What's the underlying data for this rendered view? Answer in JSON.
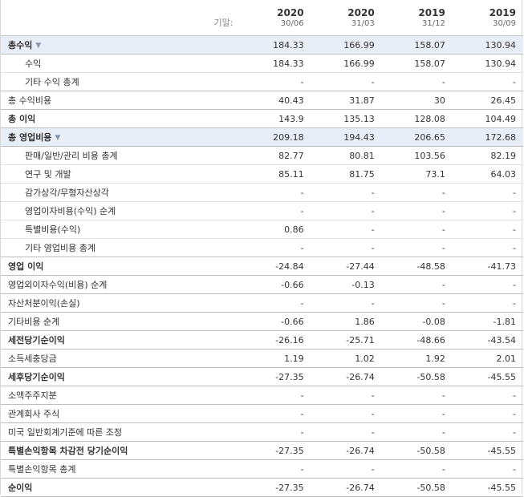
{
  "header": {
    "label": "기말:",
    "columns": [
      {
        "year": "2020",
        "date": "30/06"
      },
      {
        "year": "2020",
        "date": "31/03"
      },
      {
        "year": "2019",
        "date": "31/12"
      },
      {
        "year": "2019",
        "date": "30/09"
      }
    ]
  },
  "rows": [
    {
      "label": "총수익",
      "values": [
        "184.33",
        "166.99",
        "158.07",
        "130.94"
      ]
    },
    {
      "label": "수익",
      "values": [
        "184.33",
        "166.99",
        "158.07",
        "130.94"
      ]
    },
    {
      "label": "기타 수익 총계",
      "values": [
        "-",
        "-",
        "-",
        "-"
      ]
    },
    {
      "label": "총 수익비용",
      "values": [
        "40.43",
        "31.87",
        "30",
        "26.45"
      ]
    },
    {
      "label": "총 이익",
      "values": [
        "143.9",
        "135.13",
        "128.08",
        "104.49"
      ]
    },
    {
      "label": "총 영업비용",
      "values": [
        "209.18",
        "194.43",
        "206.65",
        "172.68"
      ]
    },
    {
      "label": "판매/일반/관리 비용 총계",
      "values": [
        "82.77",
        "80.81",
        "103.56",
        "82.19"
      ]
    },
    {
      "label": "연구 및 개발",
      "values": [
        "85.11",
        "81.75",
        "73.1",
        "64.03"
      ]
    },
    {
      "label": "감가상각/무형자산상각",
      "values": [
        "-",
        "-",
        "-",
        "-"
      ]
    },
    {
      "label": "영업이자비용(수익) 순계",
      "values": [
        "-",
        "-",
        "-",
        "-"
      ]
    },
    {
      "label": "특별비용(수익)",
      "values": [
        "0.86",
        "-",
        "-",
        "-"
      ]
    },
    {
      "label": "기타 영업비용 총계",
      "values": [
        "-",
        "-",
        "-",
        "-"
      ]
    },
    {
      "label": "영업 이익",
      "values": [
        "-24.84",
        "-27.44",
        "-48.58",
        "-41.73"
      ]
    },
    {
      "label": "영업외이자수익(비용) 순계",
      "values": [
        "-0.66",
        "-0.13",
        "-",
        "-"
      ]
    },
    {
      "label": "자산처분이익(손실)",
      "values": [
        "-",
        "-",
        "-",
        "-"
      ]
    },
    {
      "label": "기타비용 순계",
      "values": [
        "-0.66",
        "1.86",
        "-0.08",
        "-1.81"
      ]
    },
    {
      "label": "세전당기순이익",
      "values": [
        "-26.16",
        "-25.71",
        "-48.66",
        "-43.54"
      ]
    },
    {
      "label": "소득세충당금",
      "values": [
        "1.19",
        "1.02",
        "1.92",
        "2.01"
      ]
    },
    {
      "label": "세후당기순이익",
      "values": [
        "-27.35",
        "-26.74",
        "-50.58",
        "-45.55"
      ]
    },
    {
      "label": "소액주주지분",
      "values": [
        "-",
        "-",
        "-",
        "-"
      ]
    },
    {
      "label": "관계회사 주식",
      "values": [
        "-",
        "-",
        "-",
        "-"
      ]
    },
    {
      "label": "미국 일반회계기준에 따른 조정",
      "values": [
        "-",
        "-",
        "-",
        "-"
      ]
    },
    {
      "label": "특별손익항목 차감전 당기순이익",
      "values": [
        "-27.35",
        "-26.74",
        "-50.58",
        "-45.55"
      ]
    },
    {
      "label": "특별손익항목 총계",
      "values": [
        "-",
        "-",
        "-",
        "-"
      ]
    },
    {
      "label": "순이익",
      "values": [
        "-27.35",
        "-26.74",
        "-50.58",
        "-45.55"
      ]
    }
  ]
}
